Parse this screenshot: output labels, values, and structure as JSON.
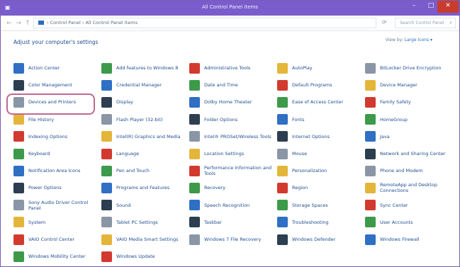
{
  "window": {
    "title": "All Control Panel Items",
    "min_glyph": "–",
    "max_glyph": "□",
    "close_glyph": "✕"
  },
  "nav": {
    "back": "←",
    "forward": "→",
    "up": "↑",
    "address": "› Control Panel › All Control Panel Items",
    "refresh": "⟳",
    "search_placeholder": "Search Control Panel",
    "search_icon": "⌕"
  },
  "heading": "Adjust your computer's settings",
  "view_by": {
    "label": "View by:",
    "value": "Large icons ▾"
  },
  "items": [
    [
      "Action Center",
      "Add features to Windows 8",
      "Administrative Tools",
      "AutoPlay",
      "BitLocker Drive Encryption"
    ],
    [
      "Color Management",
      "Credential Manager",
      "Date and Time",
      "Default Programs",
      "Device Manager"
    ],
    [
      "Devices and Printers",
      "Display",
      "Dolby Home Theater",
      "Ease of Access Center",
      "Family Safety"
    ],
    [
      "File History",
      "Flash Player (32-bit)",
      "Folder Options",
      "Fonts",
      "HomeGroup"
    ],
    [
      "Indexing Options",
      "Intel(R) Graphics and Media",
      "Intel® PROSet/Wireless Tools",
      "Internet Options",
      "Java"
    ],
    [
      "Keyboard",
      "Language",
      "Location Settings",
      "Mouse",
      "Network and Sharing Center"
    ],
    [
      "Notification Area Icons",
      "Pen and Touch",
      "Performance Information and Tools",
      "Personalization",
      "Phone and Modem"
    ],
    [
      "Power Options",
      "Programs and Features",
      "Recovery",
      "Region",
      "RemoteApp and Desktop Connections"
    ],
    [
      "Sony Audio Driver Control Panel",
      "Sound",
      "Speech Recognition",
      "Storage Spaces",
      "Sync Center"
    ],
    [
      "System",
      "Tablet PC Settings",
      "Taskbar",
      "Troubleshooting",
      "User Accounts"
    ],
    [
      "VAIO Control Center",
      "VAIO Media Smart Settings",
      "Windows 7 File Recovery",
      "Windows Defender",
      "Windows Firewall"
    ],
    [
      "Windows Mobility Center",
      "Windows Update",
      "",
      "",
      ""
    ]
  ],
  "icon_colors": {
    "blue": "#2f6fc4",
    "green": "#3c9a4a",
    "red": "#d23a2f",
    "yellow": "#e3b63a",
    "gray": "#8a96a6",
    "dark": "#2c3e50"
  },
  "highlight_color": "#c0698f"
}
